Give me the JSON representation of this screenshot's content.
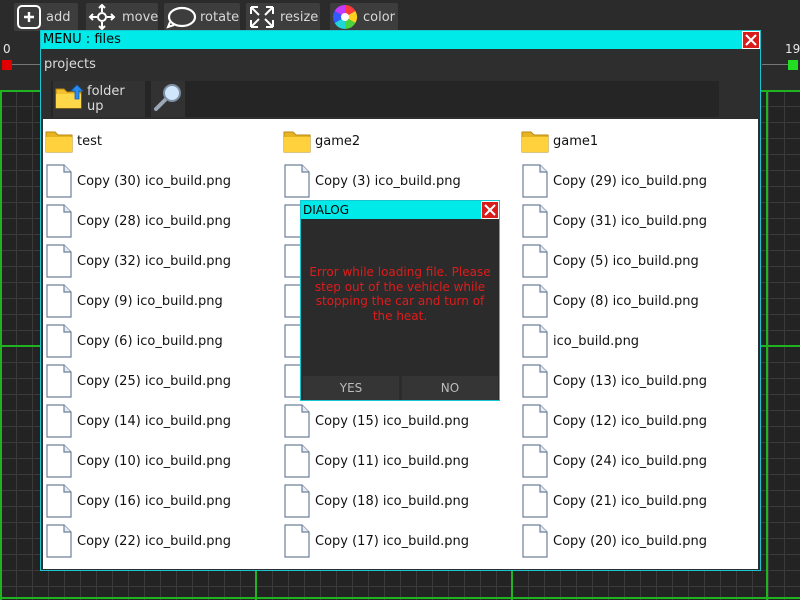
{
  "toolbar": {
    "tools": [
      {
        "label": "add",
        "icon": "add-icon"
      },
      {
        "label": "move",
        "icon": "move-icon"
      },
      {
        "label": "rotate",
        "icon": "rotate-icon"
      },
      {
        "label": "resize",
        "icon": "resize-icon"
      },
      {
        "label": "color",
        "icon": "color-wheel-icon"
      }
    ]
  },
  "ruler": {
    "left": "0",
    "right": "19"
  },
  "colors": {
    "accent": "#00eaea",
    "close": "#d81b1b",
    "grid_line": "#1fb41f",
    "error_text": "#e01b1b",
    "marker_left": "#e00000",
    "marker_right": "#22dd22"
  },
  "window": {
    "title": "MENU : files",
    "breadcrumb": "projects",
    "folder_up_label": "folder up",
    "search_icon": "magnifier-icon"
  },
  "files": [
    {
      "name": "test",
      "type": "folder"
    },
    {
      "name": "game2",
      "type": "folder"
    },
    {
      "name": "game1",
      "type": "folder"
    },
    {
      "name": "Copy (30) ico_build.png",
      "type": "file"
    },
    {
      "name": "Copy (3) ico_build.png",
      "type": "file"
    },
    {
      "name": "Copy (29) ico_build.png",
      "type": "file"
    },
    {
      "name": "Copy (28) ico_build.png",
      "type": "file"
    },
    {
      "name": "",
      "type": "file"
    },
    {
      "name": "Copy (31) ico_build.png",
      "type": "file"
    },
    {
      "name": "Copy (32) ico_build.png",
      "type": "file"
    },
    {
      "name": "",
      "type": "file"
    },
    {
      "name": "Copy (5) ico_build.png",
      "type": "file"
    },
    {
      "name": "Copy (9) ico_build.png",
      "type": "file"
    },
    {
      "name": "",
      "type": "file"
    },
    {
      "name": "Copy (8) ico_build.png",
      "type": "file"
    },
    {
      "name": "Copy (6) ico_build.png",
      "type": "file"
    },
    {
      "name": "",
      "type": "file"
    },
    {
      "name": "ico_build.png",
      "type": "file"
    },
    {
      "name": "Copy (25) ico_build.png",
      "type": "file"
    },
    {
      "name": "",
      "type": "file"
    },
    {
      "name": "Copy (13) ico_build.png",
      "type": "file"
    },
    {
      "name": "Copy (14) ico_build.png",
      "type": "file"
    },
    {
      "name": "Copy (15) ico_build.png",
      "type": "file"
    },
    {
      "name": "Copy (12) ico_build.png",
      "type": "file"
    },
    {
      "name": "Copy (10) ico_build.png",
      "type": "file"
    },
    {
      "name": "Copy (11) ico_build.png",
      "type": "file"
    },
    {
      "name": "Copy (24) ico_build.png",
      "type": "file"
    },
    {
      "name": "Copy (16) ico_build.png",
      "type": "file"
    },
    {
      "name": "Copy (18) ico_build.png",
      "type": "file"
    },
    {
      "name": "Copy (21) ico_build.png",
      "type": "file"
    },
    {
      "name": "Copy (22) ico_build.png",
      "type": "file"
    },
    {
      "name": "Copy (17) ico_build.png",
      "type": "file"
    },
    {
      "name": "Copy (20) ico_build.png",
      "type": "file"
    }
  ],
  "dialog": {
    "title": "DIALOG",
    "message": "Error while loading file. Please step out of the vehicle while stopping the car and turn of the heat.",
    "yes_label": "YES",
    "no_label": "NO"
  }
}
